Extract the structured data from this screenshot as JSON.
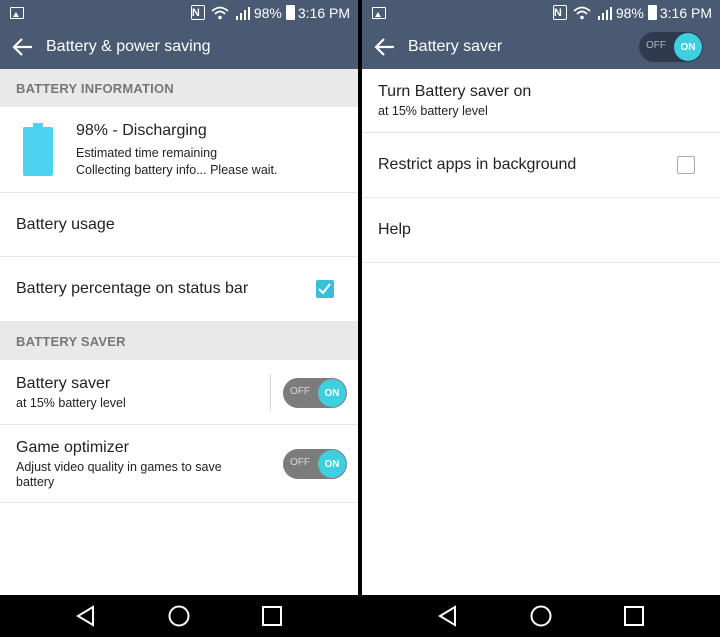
{
  "status_bar": {
    "battery_percent": "98%",
    "time": "3:16 PM",
    "icons": [
      "gallery-notification-icon",
      "nfc-icon",
      "wifi-icon",
      "signal-icon",
      "battery-icon"
    ]
  },
  "left": {
    "appbar": {
      "title": "Battery & power saving"
    },
    "battery_information": {
      "header": "BATTERY INFORMATION",
      "status": "98% - Discharging",
      "estimated_label": "Estimated time remaining",
      "collecting": "Collecting battery info... Please wait.",
      "level": 0.98,
      "icon_color": "#4dd3f0"
    },
    "battery_usage": {
      "title": "Battery usage"
    },
    "battery_percentage": {
      "title": "Battery percentage on status bar",
      "checked": true
    },
    "battery_saver_section": {
      "header": "BATTERY SAVER"
    },
    "battery_saver": {
      "title": "Battery saver",
      "subtitle": "at 15% battery level",
      "off_label": "OFF",
      "on_label": "ON"
    },
    "game_optimizer": {
      "title": "Game optimizer",
      "subtitle_line1": "Adjust video quality in games to save",
      "subtitle_line2": "battery",
      "off_label": "OFF",
      "on_label": "ON"
    }
  },
  "right": {
    "appbar": {
      "title": "Battery saver",
      "off_label": "OFF",
      "on_label": "ON"
    },
    "turn_on": {
      "title": "Turn Battery saver on",
      "subtitle": "at 15% battery level"
    },
    "restrict_apps": {
      "title": "Restrict apps in background",
      "checked": false
    },
    "help": {
      "title": "Help"
    }
  },
  "colors": {
    "appbar": "#4a5a73",
    "accent": "#35c1d6",
    "toggle_on": "#3ecfe0",
    "section_bg": "#e9e9e9"
  }
}
